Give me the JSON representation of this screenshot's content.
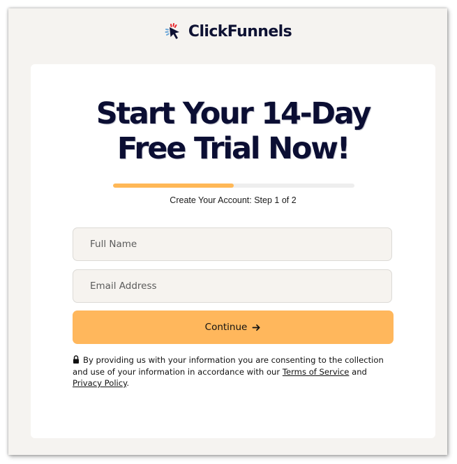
{
  "brand": {
    "name": "ClickFunnels",
    "icon": "cursor-arrow-logo-icon",
    "colors": {
      "dark": "#0e1233",
      "red": "#e8252b",
      "blue": "#6aa6d8"
    }
  },
  "hero": {
    "title_line1": "Start Your 14-Day",
    "title_line2": "Free Trial Now!"
  },
  "progress": {
    "value": 0.5,
    "color": "#ffb857",
    "label": "Create Your Account: Step 1 of 2"
  },
  "form": {
    "full_name_placeholder": "Full Name",
    "full_name_value": "",
    "email_placeholder": "Email Address",
    "email_value": "",
    "continue_label": "Continue",
    "continue_icon": "arrow-right-icon",
    "button_color": "#ffb75c"
  },
  "consent": {
    "icon": "lock-icon",
    "text_before": "By providing us with your information you are consenting to the collection and use of your information in accordance with our ",
    "terms_link": "Terms of Service",
    "text_middle": " and ",
    "privacy_link": "Privacy Policy",
    "text_after": "."
  }
}
